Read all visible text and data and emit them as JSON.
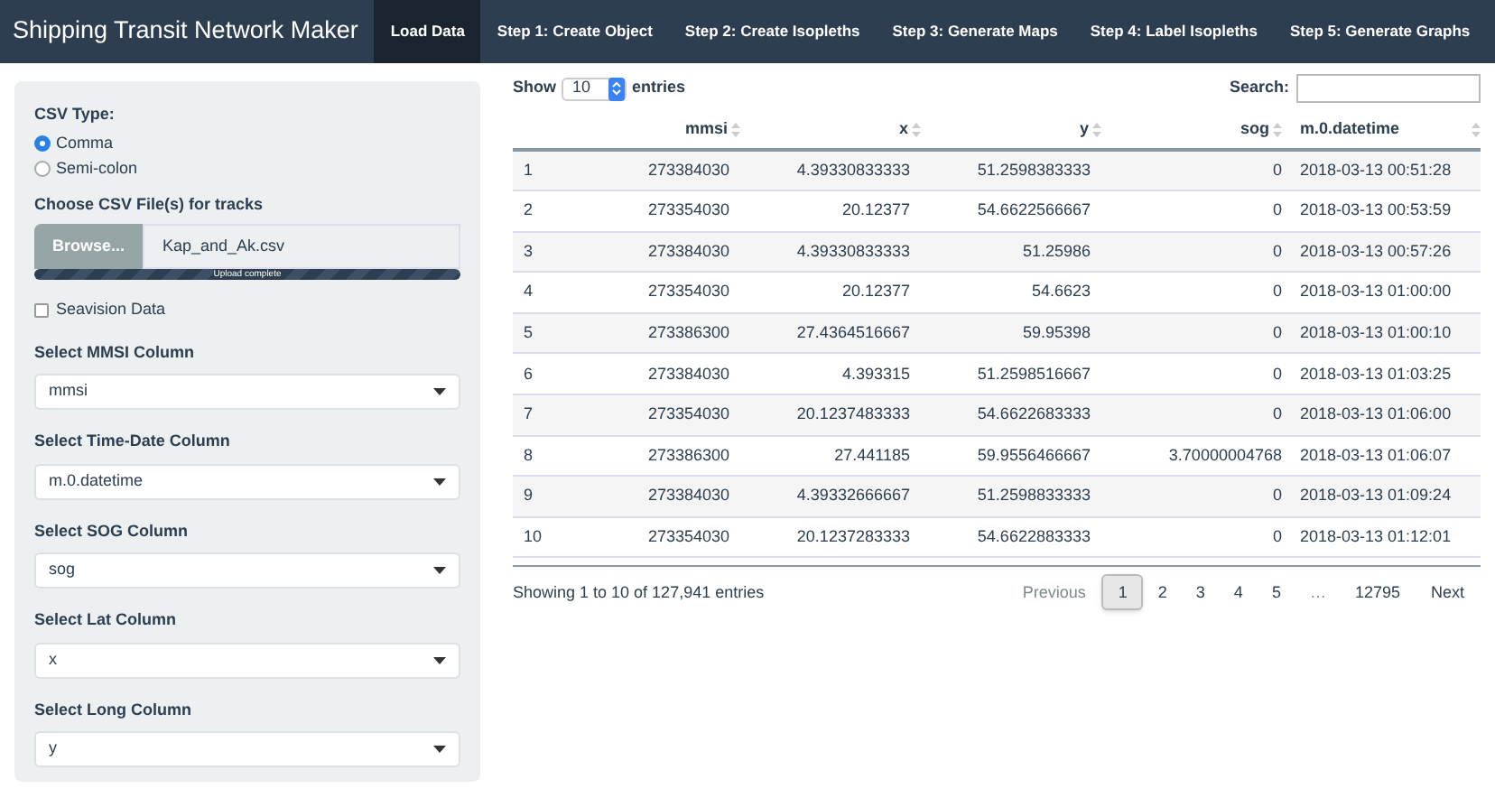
{
  "navbar": {
    "title": "Shipping Transit Network Maker",
    "tabs": [
      {
        "label": "Load Data",
        "selected": true
      },
      {
        "label": "Step 1: Create Object",
        "selected": false
      },
      {
        "label": "Step 2: Create Isopleths",
        "selected": false
      },
      {
        "label": "Step 3: Generate Maps",
        "selected": false
      },
      {
        "label": "Step 4: Label Isopleths",
        "selected": false
      },
      {
        "label": "Step 5: Generate Graphs",
        "selected": false
      }
    ]
  },
  "sidebar": {
    "csv_type": {
      "label": "CSV Type:",
      "options": [
        {
          "label": "Comma",
          "selected": true
        },
        {
          "label": "Semi-colon",
          "selected": false
        }
      ]
    },
    "file_input": {
      "label": "Choose CSV File(s) for tracks",
      "button": "Browse...",
      "value": "Kap_and_Ak.csv",
      "progress": {
        "level": 1,
        "text": "Upload complete"
      }
    },
    "seavision": {
      "label": "Seavision Data",
      "checked": false
    },
    "selects": [
      {
        "label": "Select MMSI Column",
        "value": "mmsi"
      },
      {
        "label": "Select Time-Date Column",
        "value": "m.0.datetime"
      },
      {
        "label": "Select SOG Column",
        "value": "sog"
      },
      {
        "label": "Select Lat Column",
        "value": "x"
      },
      {
        "label": "Select Long Column",
        "value": "y"
      }
    ]
  },
  "table": {
    "show_label": "Show",
    "length": "10",
    "entries_label": "entries",
    "search_label": "Search:",
    "columns": [
      "",
      "mmsi",
      "x",
      "y",
      "sog",
      "m.0.datetime"
    ],
    "rows": [
      [
        "1",
        "273384030",
        "4.39330833333",
        "51.2598383333",
        "0",
        "2018-03-13 00:51:28"
      ],
      [
        "2",
        "273354030",
        "20.12377",
        "54.6622566667",
        "0",
        "2018-03-13 00:53:59"
      ],
      [
        "3",
        "273384030",
        "4.39330833333",
        "51.25986",
        "0",
        "2018-03-13 00:57:26"
      ],
      [
        "4",
        "273354030",
        "20.12377",
        "54.6623",
        "0",
        "2018-03-13 01:00:00"
      ],
      [
        "5",
        "273386300",
        "27.4364516667",
        "59.95398",
        "0",
        "2018-03-13 01:00:10"
      ],
      [
        "6",
        "273384030",
        "4.393315",
        "51.2598516667",
        "0",
        "2018-03-13 01:03:25"
      ],
      [
        "7",
        "273354030",
        "20.1237483333",
        "54.6622683333",
        "0",
        "2018-03-13 01:06:00"
      ],
      [
        "8",
        "273386300",
        "27.441185",
        "59.9556466667",
        "3.70000004768",
        "2018-03-13 01:06:07"
      ],
      [
        "9",
        "273384030",
        "4.39332666667",
        "51.2598833333",
        "0",
        "2018-03-13 01:09:24"
      ],
      [
        "10",
        "273354030",
        "20.1237283333",
        "54.6622883333",
        "0",
        "2018-03-13 01:12:01"
      ]
    ],
    "info": "Showing 1 to 10 of 127,941 entries",
    "pagination": [
      {
        "label": "Previous",
        "kind": "nav",
        "selected": false
      },
      {
        "label": "1",
        "kind": "page",
        "selected": true
      },
      {
        "label": "2",
        "kind": "page",
        "selected": false
      },
      {
        "label": "3",
        "kind": "page",
        "selected": false
      },
      {
        "label": "4",
        "kind": "page",
        "selected": false
      },
      {
        "label": "5",
        "kind": "page",
        "selected": false
      },
      {
        "label": "…",
        "kind": "ellipsis",
        "selected": false
      },
      {
        "label": "12795",
        "kind": "page",
        "selected": false
      },
      {
        "label": "Next",
        "kind": "nav",
        "selected": false
      }
    ]
  }
}
